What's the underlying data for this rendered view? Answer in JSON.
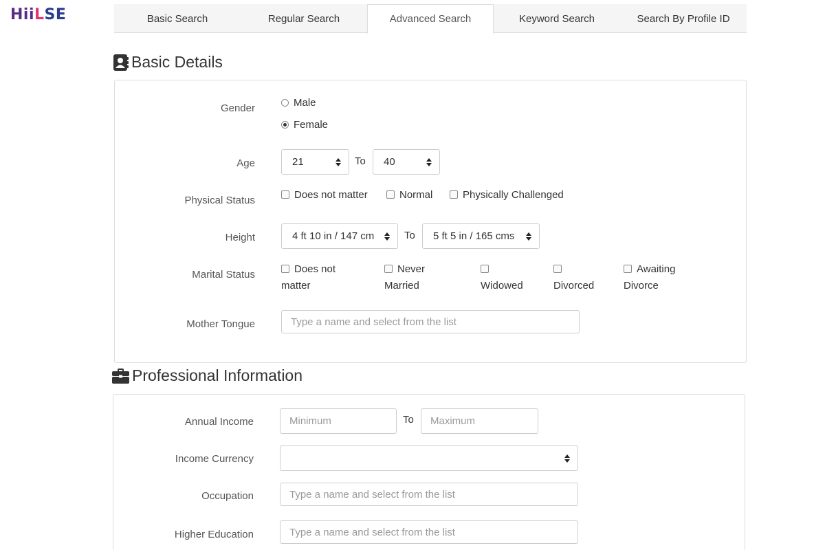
{
  "logo": {
    "part1": "Hii",
    "part2": "L",
    "part3": "SE"
  },
  "tabs": [
    {
      "label": "Basic Search"
    },
    {
      "label": "Regular Search"
    },
    {
      "label": "Advanced Search"
    },
    {
      "label": "Keyword Search"
    },
    {
      "label": "Search By Profile ID"
    }
  ],
  "active_tab": "Advanced Search",
  "basic": {
    "title": "Basic Details",
    "gender": {
      "label": "Gender",
      "options": [
        "Male",
        "Female"
      ],
      "selected": "Female"
    },
    "age": {
      "label": "Age",
      "from": "21",
      "to_label": "To",
      "to": "40"
    },
    "physical": {
      "label": "Physical Status",
      "options": [
        "Does not matter",
        "Normal",
        "Physically Challenged"
      ]
    },
    "height": {
      "label": "Height",
      "from": "4 ft 10 in / 147 cm",
      "to_label": "To",
      "to": "5 ft 5 in / 165 cms"
    },
    "marital": {
      "label": "Marital Status",
      "options": [
        {
          "l1": "Does not",
          "l2": "matter"
        },
        {
          "l1": "Never",
          "l2": "Married"
        },
        {
          "l1": "",
          "l2": "Widowed"
        },
        {
          "l1": "",
          "l2": "Divorced"
        },
        {
          "l1": "Awaiting",
          "l2": "Divorce"
        }
      ]
    },
    "tongue": {
      "label": "Mother Tongue",
      "placeholder": "Type a name and select from the list"
    }
  },
  "professional": {
    "title": "Professional Information",
    "income": {
      "label": "Annual Income",
      "min_placeholder": "Minimum",
      "to_label": "To",
      "max_placeholder": "Maximum"
    },
    "currency": {
      "label": "Income Currency",
      "value": ""
    },
    "occupation": {
      "label": "Occupation",
      "placeholder": "Type a name and select from the list"
    },
    "education": {
      "label": "Higher Education",
      "placeholder": "Type a name and select from the list"
    }
  },
  "icons": {
    "basic": "contact-card-icon",
    "professional": "briefcase-icon",
    "select": "updown-caret-icon"
  }
}
